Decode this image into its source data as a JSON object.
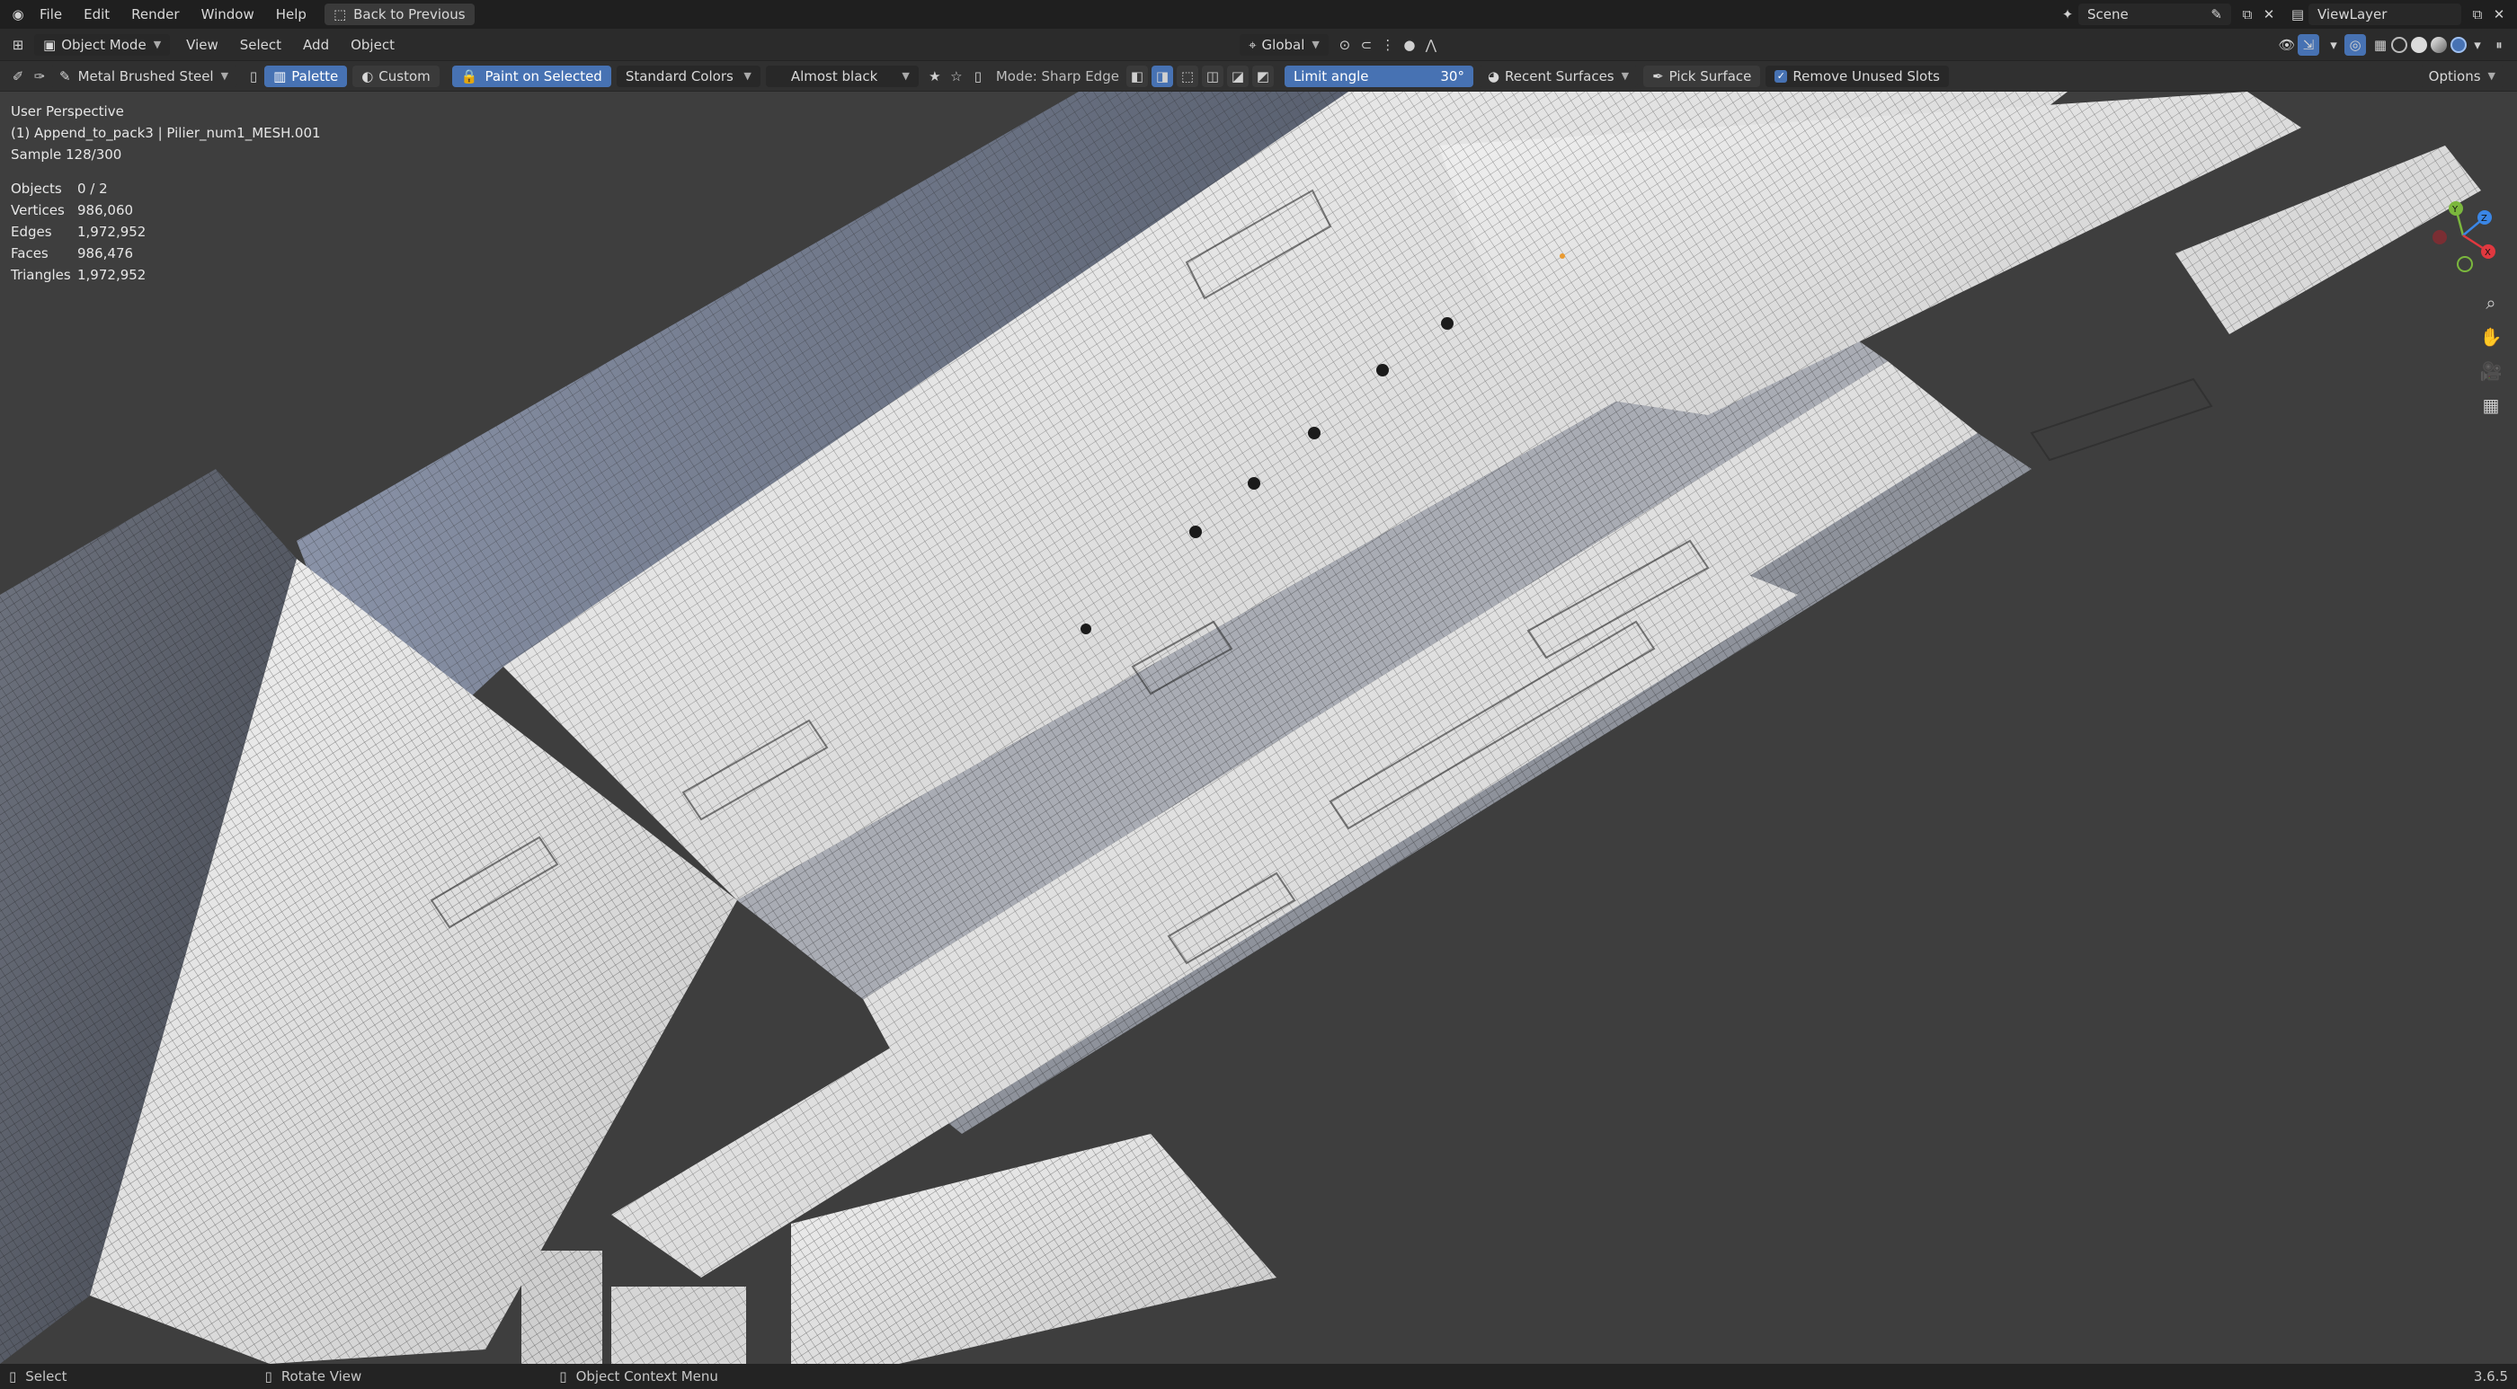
{
  "topbar": {
    "menu": [
      "File",
      "Edit",
      "Render",
      "Window",
      "Help"
    ],
    "back_label": "Back to Previous",
    "scene": "Scene",
    "viewlayer": "ViewLayer"
  },
  "header": {
    "mode": "Object Mode",
    "menu": [
      "View",
      "Select",
      "Add",
      "Object"
    ],
    "transform_orientation": "Global"
  },
  "toolbar": {
    "material": "Metal Brushed Steel",
    "palette_label": "Palette",
    "custom_label": "Custom",
    "paint_on_selected": "Paint on Selected",
    "palette_set": "Standard Colors",
    "color_name": "Almost black",
    "mode_label": "Mode: Sharp Edge",
    "limit_angle_label": "Limit angle",
    "limit_angle_value": "30°",
    "recent_surfaces": "Recent Surfaces",
    "pick_surface": "Pick Surface",
    "remove_unused_slots": "Remove Unused Slots",
    "remove_unused_checked": true,
    "options_label": "Options"
  },
  "overlay": {
    "perspective": "User Perspective",
    "object_name": "(1) Append_to_pack3 | Pilier_num1_MESH.001",
    "sample": "Sample 128/300",
    "stats": [
      {
        "label": "Objects",
        "value": "0 / 2"
      },
      {
        "label": "Vertices",
        "value": "986,060"
      },
      {
        "label": "Edges",
        "value": "1,972,952"
      },
      {
        "label": "Faces",
        "value": "986,476"
      },
      {
        "label": "Triangles",
        "value": "1,972,952"
      }
    ]
  },
  "gizmo": {
    "axes": [
      "Y",
      "Z",
      "X"
    ],
    "colors": {
      "x": "#e0383f",
      "y": "#7bb73d",
      "z": "#3a86e6"
    }
  },
  "statusbar": {
    "items": [
      "Select",
      "Rotate View",
      "Object Context Menu"
    ],
    "version": "3.6.5"
  },
  "colors": {
    "accent": "#4772b3",
    "viewport_bg": "#3e3e3e"
  }
}
